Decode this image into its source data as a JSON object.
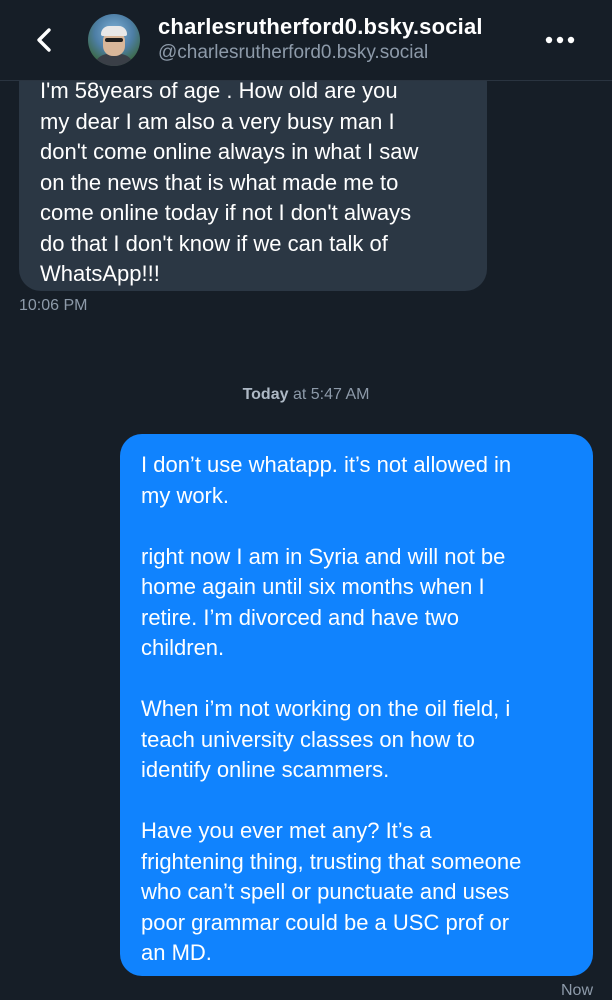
{
  "header": {
    "display_name": "charlesrutherford0.bsky.social",
    "handle": "@charlesrutherford0.bsky.social",
    "back_icon": "chevron-left-icon",
    "more_icon": "more-horizontal-icon"
  },
  "messages": [
    {
      "direction": "incoming",
      "text": "I'm 58years of age . How old are you\nmy dear I am also a very busy man I\ndon't come online always in what I saw\non the news that is what made me to\ncome online today if not I don't always\ndo that I don't know if we can talk of\nWhatsApp!!!",
      "time": "10:06 PM"
    },
    {
      "direction": "outgoing",
      "text": "I don’t use whatapp. it’s not allowed in\nmy work.\n\nright now I am in Syria and will not be\nhome again until six months when I\nretire. I’m divorced and have two\nchildren.\n\nWhen i’m not working on the oil field, i\nteach university classes on how to\nidentify online scammers.\n\nHave you ever met any?  It’s a\nfrightening thing, trusting that someone\nwho can’t spell or punctuate and uses\npoor grammar could be a USC prof or\nan MD.",
      "time": "Now"
    }
  ],
  "date_separator": {
    "day": "Today",
    "rest": " at 5:47 AM"
  },
  "colors": {
    "background": "#161e27",
    "incoming_bubble": "#2b3744",
    "outgoing_bubble": "#1083fe",
    "muted_text": "#8d9aa9"
  }
}
